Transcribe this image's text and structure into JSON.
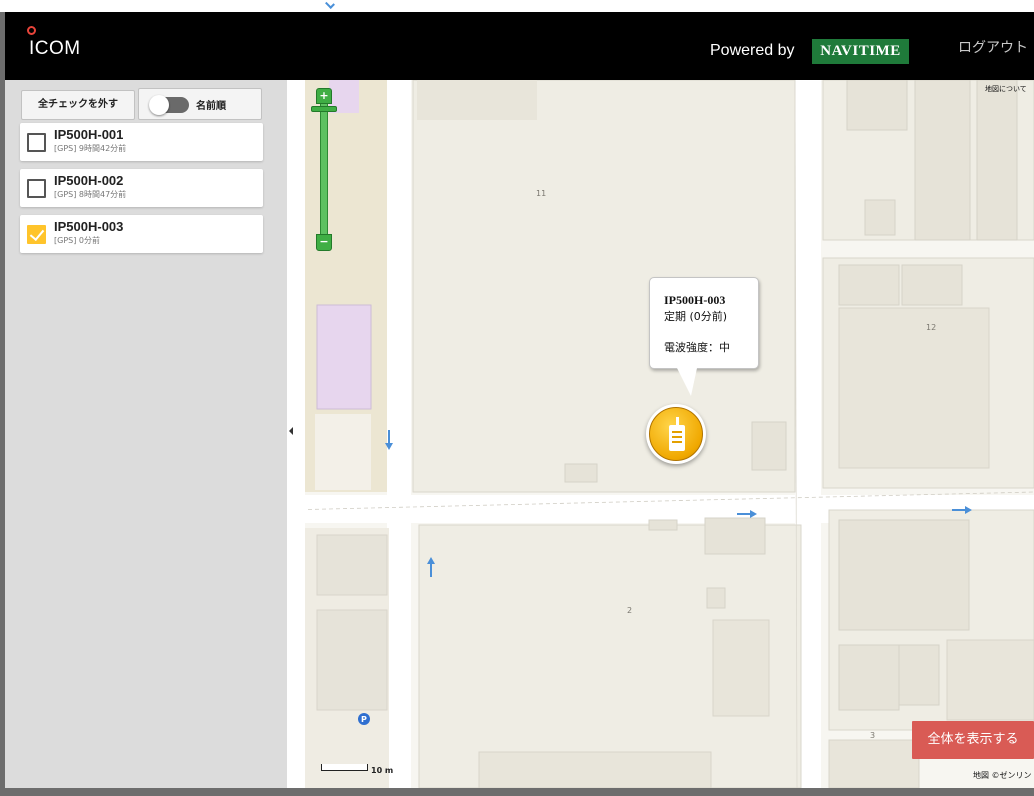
{
  "header": {
    "logo_text": "ICOM",
    "powered_by": "Powered by",
    "navitime": "NAVITIME",
    "logout": "ログアウト"
  },
  "sidebar": {
    "uncheck_all_label": "全チェックを外す",
    "sort_label": "名前順",
    "devices": [
      {
        "name": "IP500H-001",
        "status": "[GPS] 9時間42分前",
        "checked": false
      },
      {
        "name": "IP500H-002",
        "status": "[GPS] 8時間47分前",
        "checked": false
      },
      {
        "name": "IP500H-003",
        "status": "[GPS] 0分前",
        "checked": true
      }
    ]
  },
  "map": {
    "attribution": "地図について",
    "copyright": "地図 ©ゼンリン",
    "scale": "10 m",
    "zoom_in": "+",
    "zoom_out": "−",
    "show_all_label": "全体を表示する",
    "block_labels": [
      "11",
      "12",
      "2",
      "3"
    ],
    "popup": {
      "name": "IP500H-003",
      "type": "定期 (0分前)",
      "signal": "電波強度：中"
    },
    "colors": {
      "marker": "#f0a800",
      "show_all_button": "#d95b55",
      "zoom_control": "#3fae44",
      "navitime_badge": "#1f7a3a"
    },
    "icons": [
      "radio-marker-icon",
      "parking-icon",
      "one-way-arrow-icon"
    ]
  }
}
